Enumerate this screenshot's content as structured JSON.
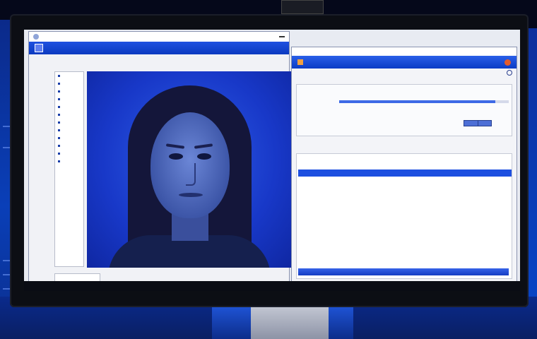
{
  "left_window": {
    "title": "",
    "menu": "",
    "sidebar_items": [
      "",
      "",
      "",
      "",
      "",
      "",
      "",
      "",
      "",
      "",
      "",
      "",
      "",
      ""
    ],
    "status": ""
  },
  "right_window": {
    "title": "",
    "header": "",
    "panel_progress_fraction": 0.92
  },
  "colors": {
    "accent": "#1d4fe0",
    "photo_background": "#1838c8"
  },
  "icons": [
    "window-icon",
    "close-icon",
    "search-icon",
    "folder-icon"
  ]
}
